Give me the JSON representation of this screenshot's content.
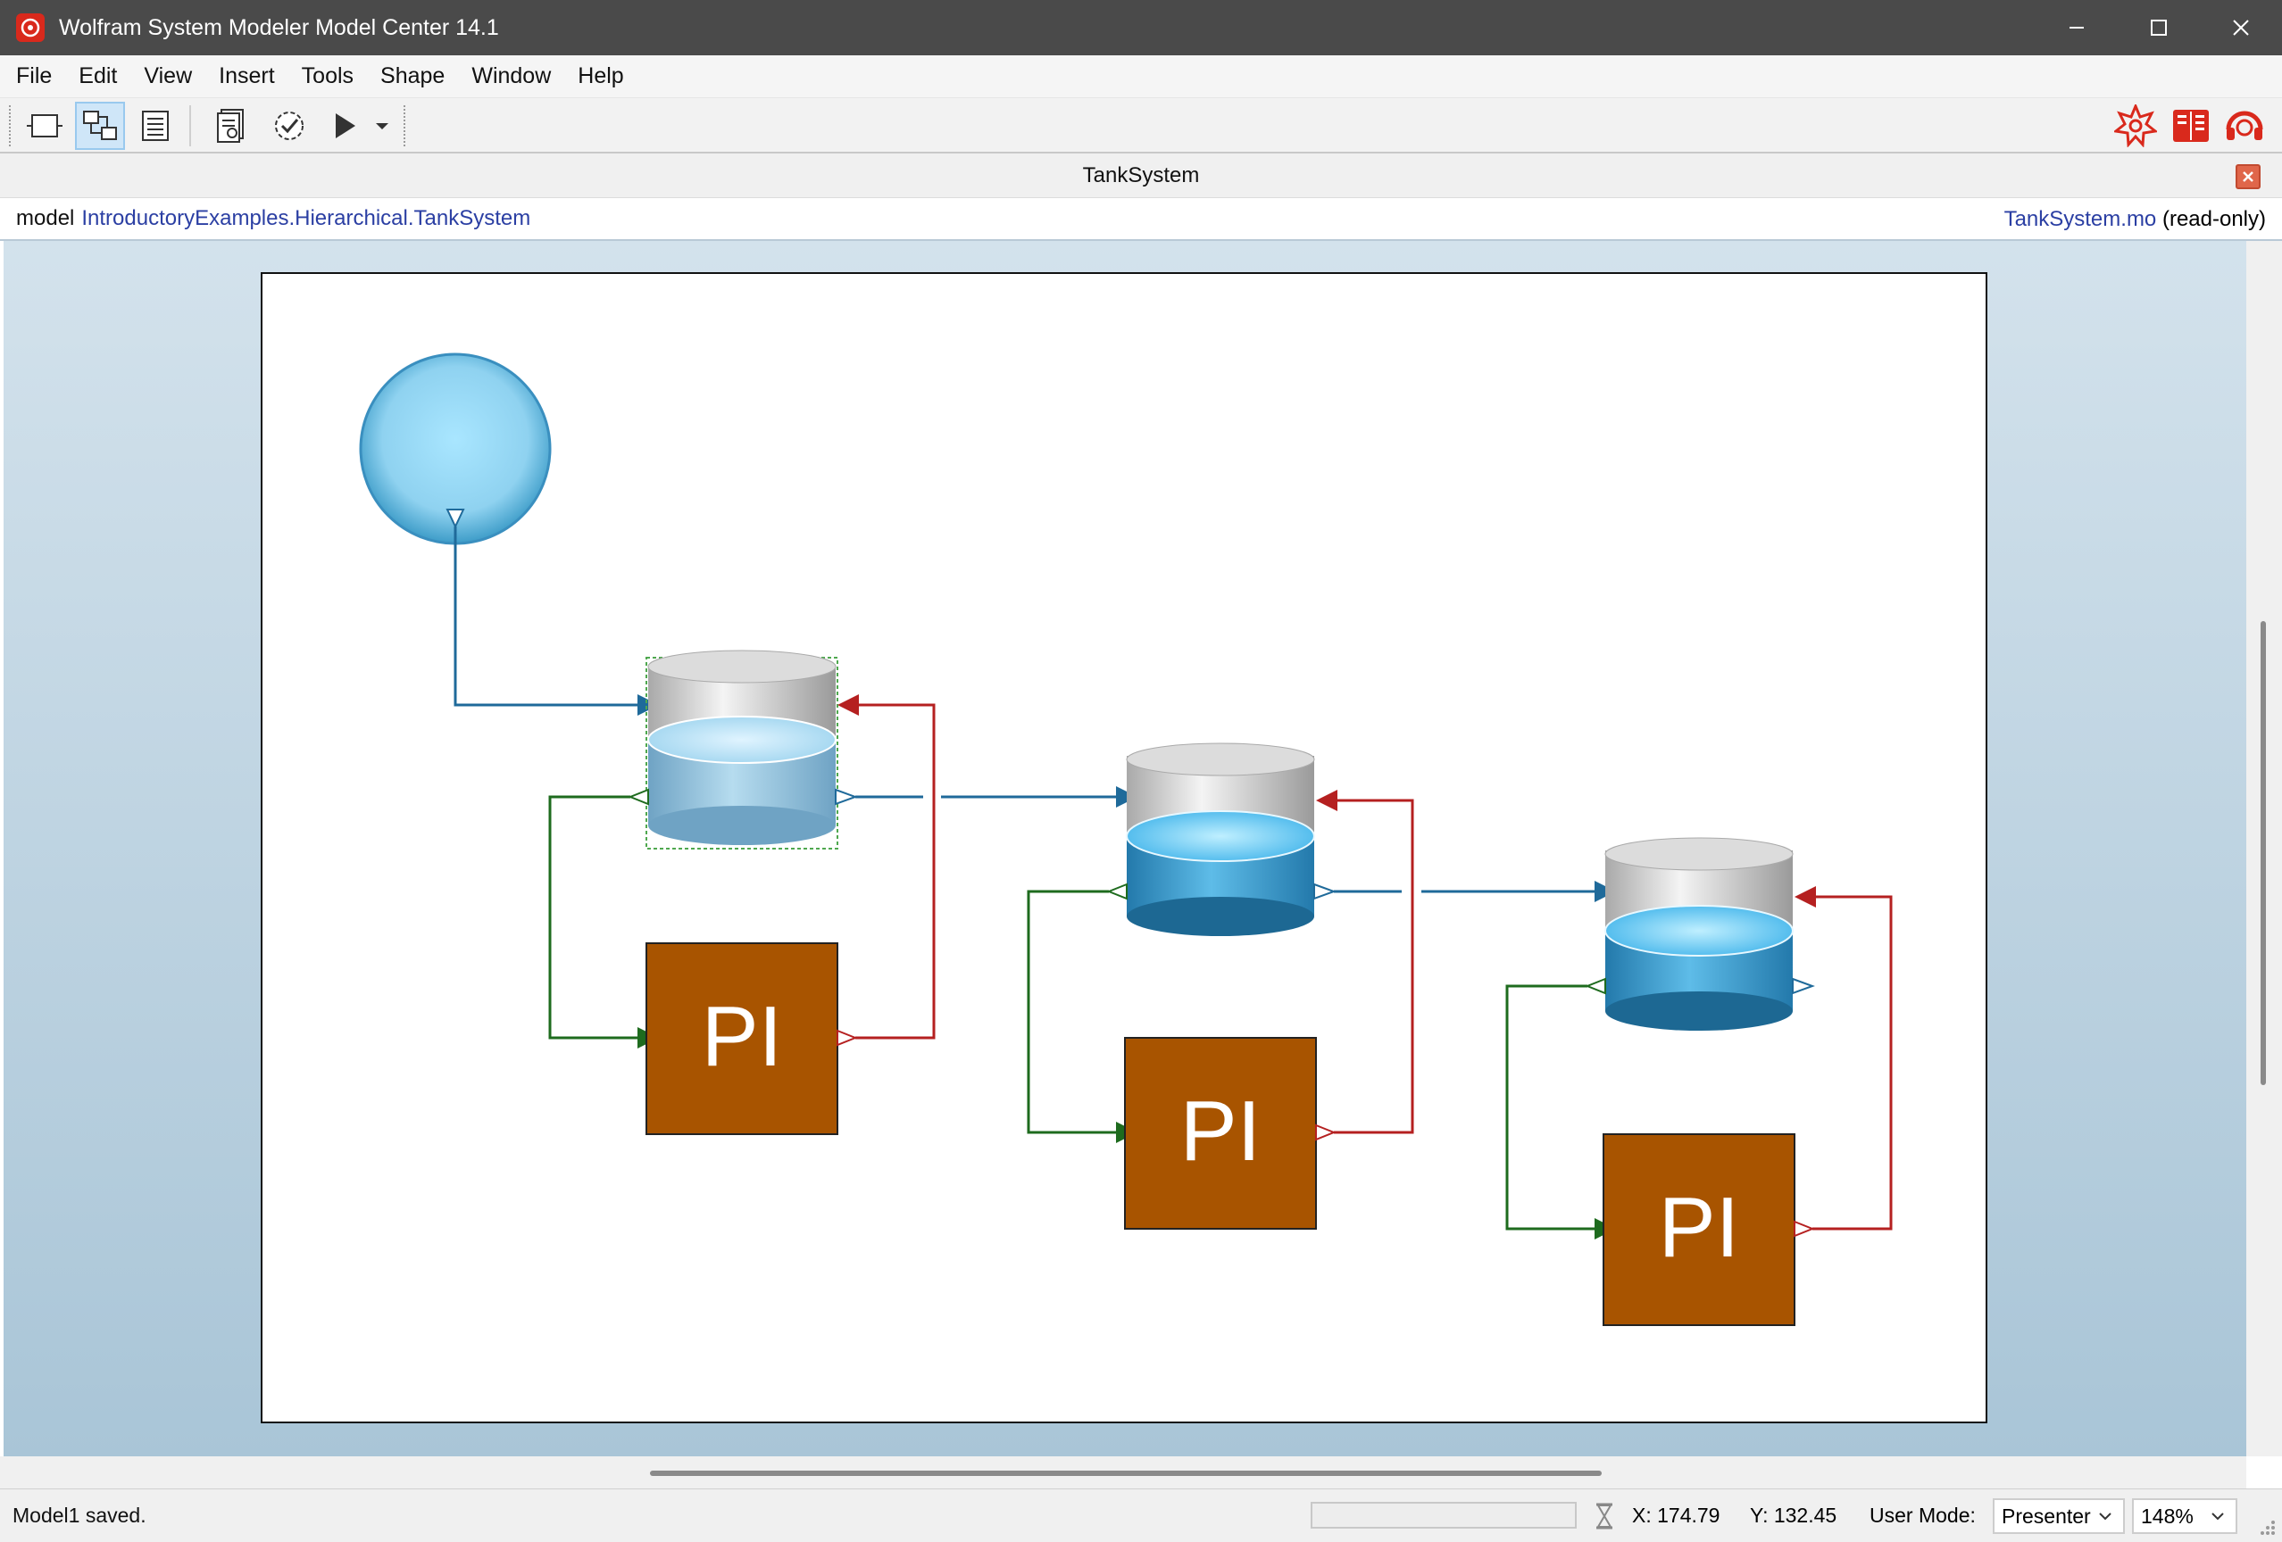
{
  "window": {
    "title": "Wolfram System Modeler Model Center 14.1"
  },
  "menu": {
    "items": [
      {
        "label": "File"
      },
      {
        "label": "Edit"
      },
      {
        "label": "View"
      },
      {
        "label": "Insert"
      },
      {
        "label": "Tools"
      },
      {
        "label": "Shape"
      },
      {
        "label": "Window"
      },
      {
        "label": "Help"
      }
    ]
  },
  "toolbar": {
    "buttons": [
      {
        "icon": "icon-view-icon",
        "active": false
      },
      {
        "icon": "diagram-view-icon",
        "active": true
      },
      {
        "icon": "text-view-icon",
        "active": false
      },
      {
        "icon": "documentation-icon",
        "active": false
      },
      {
        "icon": "validate-icon",
        "active": false
      },
      {
        "icon": "simulate-icon",
        "active": false
      },
      {
        "icon": "simulate-dropdown-icon",
        "active": false
      }
    ],
    "right_icons": [
      "wolfram-spikey-icon",
      "documentation-center-icon",
      "support-icon"
    ],
    "accent": "#d9291c"
  },
  "document": {
    "tab_title": "TankSystem",
    "path_keyword": "model",
    "path": "IntroductoryExamples.Hierarchical.TankSystem",
    "file": "TankSystem.mo",
    "file_suffix": "(read-only)"
  },
  "diagram": {
    "controllers": [
      {
        "label": "PI"
      },
      {
        "label": "PI"
      },
      {
        "label": "PI"
      }
    ],
    "colors": {
      "controller_fill": "#a85400",
      "flow_line": "#1f6a9a",
      "measure_line": "#1e6b1e",
      "control_line": "#b52020",
      "tank_water": "#4aa8d8",
      "source_fill": "#8fd2f0"
    }
  },
  "status": {
    "message": "Model1 saved.",
    "x": "X: 174.79",
    "y": "Y: 132.45",
    "mode_label": "User Mode:",
    "mode_value": "Presenter",
    "zoom": "148%"
  }
}
